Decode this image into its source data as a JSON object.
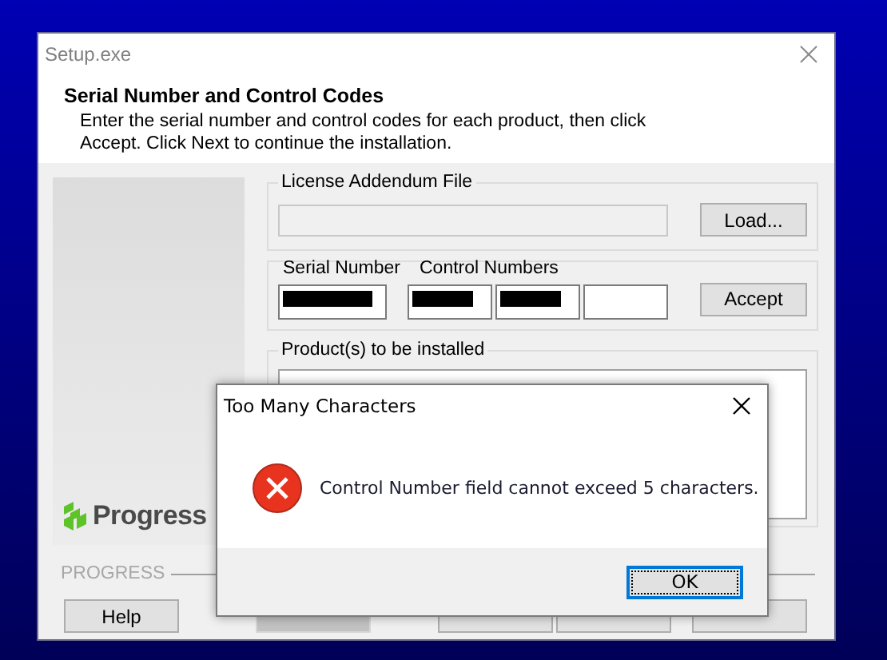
{
  "window": {
    "title": "Setup.exe"
  },
  "header": {
    "title": "Serial Number and Control Codes",
    "description_lines": [
      "Enter the serial number and control codes for each product, then click",
      "Accept. Click Next to continue the installation."
    ]
  },
  "branding": {
    "logo_text": "Progress",
    "footer_label": "PROGRESS"
  },
  "license_group": {
    "label": "License Addendum File",
    "button": "Load..."
  },
  "codes_group": {
    "serial_label": "Serial Number",
    "control_label": "Control Numbers",
    "fields": [
      {
        "kind": "redacted"
      },
      {
        "kind": "redacted"
      },
      {
        "kind": "redacted"
      },
      {
        "kind": "empty"
      }
    ],
    "button": "Accept"
  },
  "products_group": {
    "label": "Product(s) to be installed"
  },
  "buttons": [
    {
      "label": "Help",
      "disabled": false
    },
    {
      "disabled": true
    },
    {
      "disabled": false
    },
    {
      "disabled": false
    },
    {
      "disabled": false
    }
  ],
  "dialog": {
    "title": "Too Many Characters",
    "kind": "error",
    "message": "Control Number field cannot exceed 5 characters.",
    "button": "OK"
  }
}
